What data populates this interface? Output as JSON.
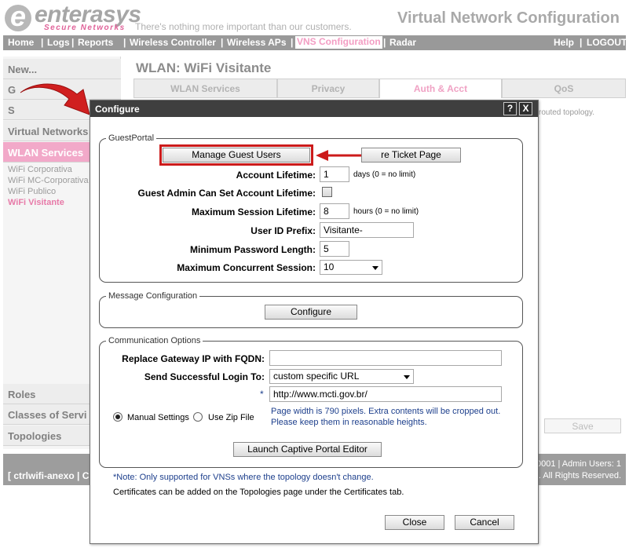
{
  "header": {
    "brand": "enterasys",
    "brand_sub": "Secure Networks",
    "tagline": "There's nothing more important than our customers.",
    "app_title": "Virtual Network Configuration"
  },
  "nav": {
    "items": [
      "Home",
      "Logs",
      "Reports",
      "Wireless Controller",
      "Wireless APs",
      "VNS Configuration",
      "Radar"
    ],
    "right": [
      "Help",
      "LOGOUT"
    ],
    "active": "VNS Configuration"
  },
  "sidebar": {
    "items": [
      "New...",
      "G",
      "S",
      "Virtual Networks",
      "WLAN Services",
      "Roles",
      "Classes of Servi",
      "Topologies"
    ],
    "wlan_list": [
      "WiFi Corporativa",
      "WiFi MC-Corporativa",
      "WiFi Publico",
      "WiFi Visitante"
    ],
    "footer": "[ ctrlwifi-anexo | C"
  },
  "main": {
    "title": "WLAN: WiFi Visitante",
    "tabs": [
      "WLAN Services",
      "Privacy",
      "Auth & Acct",
      "QoS"
    ],
    "bg_note": "routed topology.",
    "save_label": "Save",
    "footer_line1": "0001 | Admin Users: 1",
    "footer_line2": ". All Rights Reserved."
  },
  "dialog": {
    "title": "Configure",
    "help_label": "?",
    "close_label": "X",
    "guest_portal": {
      "legend": "GuestPortal",
      "manage_guest_users": "Manage Guest Users",
      "ticket_page": "re Ticket Page",
      "account_lifetime_label": "Account Lifetime:",
      "account_lifetime_value": "1",
      "account_lifetime_hint": "days (0 = no limit)",
      "guest_admin_label": "Guest Admin Can Set Account Lifetime:",
      "guest_admin_checked": false,
      "max_session_label": "Maximum Session Lifetime:",
      "max_session_value": "8",
      "max_session_hint": "hours (0 = no limit)",
      "userid_prefix_label": "User ID Prefix:",
      "userid_prefix_value": "Visitante-",
      "min_pwd_label": "Minimum Password Length:",
      "min_pwd_value": "5",
      "max_concurrent_label": "Maximum Concurrent Session:",
      "max_concurrent_value": "10"
    },
    "message_config": {
      "legend": "Message Configuration",
      "configure_label": "Configure"
    },
    "communication": {
      "legend": "Communication Options",
      "replace_gw_label": "Replace Gateway IP with FQDN:",
      "replace_gw_value": "",
      "send_login_label": "Send Successful Login To:",
      "send_login_value": "custom specific URL",
      "required_mark": "*",
      "url_value": "http://www.mcti.gov.br/",
      "manual_label": "Manual Settings",
      "zip_label": "Use Zip File",
      "manual_selected": true,
      "page_note_1": "Page width is 790 pixels. Extra contents will be cropped out.",
      "page_note_2": "Please keep them in reasonable heights.",
      "launch_label": "Launch Captive Portal Editor"
    },
    "note_vns": "*Note: Only supported for VNSs where the topology doesn't change.",
    "note_certs": "Certificates can be added on the Topologies page under the Certificates tab.",
    "close_button": "Close",
    "cancel_button": "Cancel"
  },
  "colors": {
    "accent_pink": "#e77aa8",
    "nav_gray": "#999999",
    "title_bar": "#3f3f3f",
    "highlight_red": "#cc1b1b",
    "note_blue": "#1d3f8c"
  }
}
